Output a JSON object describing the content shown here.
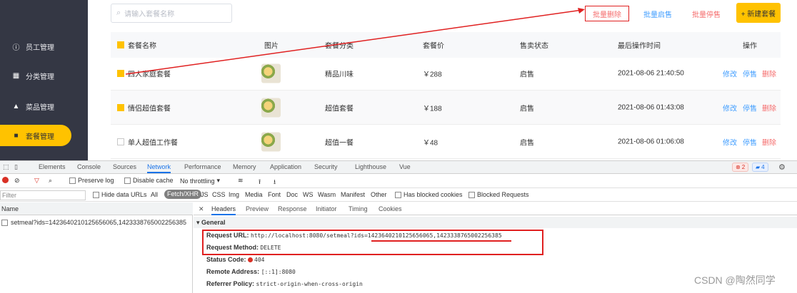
{
  "sidebar": {
    "items": [
      {
        "label": "员工管理",
        "icon": "info-icon"
      },
      {
        "label": "分类管理",
        "icon": "grid-icon"
      },
      {
        "label": "菜品管理",
        "icon": "dish-icon"
      },
      {
        "label": "套餐管理",
        "icon": "gift-icon",
        "active": true
      }
    ]
  },
  "toolbar": {
    "search_placeholder": "请输入套餐名称",
    "batch_delete": "批量删除",
    "batch_on": "批量启售",
    "batch_off": "批量停售",
    "new_button": "+ 新建套餐"
  },
  "table": {
    "headers": [
      "套餐名称",
      "图片",
      "套餐分类",
      "套餐价",
      "售卖状态",
      "最后操作时间",
      "操作"
    ],
    "rows": [
      {
        "name": "四人家庭套餐",
        "category": "精品川味",
        "price": "￥288",
        "status": "启售",
        "time": "2021-08-06 21:40:50",
        "checked": true
      },
      {
        "name": "情侣超值套餐",
        "category": "超值套餐",
        "price": "￥188",
        "status": "启售",
        "time": "2021-08-06 01:43:08",
        "checked": true
      },
      {
        "name": "单人超值工作餐",
        "category": "超值一餐",
        "price": "￥48",
        "status": "启售",
        "time": "2021-08-06 01:06:08",
        "checked": false
      }
    ],
    "ops": {
      "edit": "修改",
      "stop": "停售",
      "del": "删除"
    }
  },
  "devtools": {
    "tabs": [
      "Elements",
      "Console",
      "Sources",
      "Network",
      "Performance",
      "Memory",
      "Application",
      "Security",
      "Lighthouse",
      "Vue"
    ],
    "active_tab": "Network",
    "errors": "2",
    "messages": "4",
    "toolbar": {
      "preserve_log": "Preserve log",
      "disable_cache": "Disable cache",
      "throttling": "No throttling"
    },
    "filter": {
      "placeholder": "Filter",
      "hide_data_urls": "Hide data URLs",
      "all": "All",
      "types": [
        "Fetch/XHR",
        "JS",
        "CSS",
        "Img",
        "Media",
        "Font",
        "Doc",
        "WS",
        "Wasm",
        "Manifest",
        "Other"
      ],
      "blocked_cookies": "Has blocked cookies",
      "blocked_requests": "Blocked Requests"
    },
    "name_header": "Name",
    "request_name": "setmeal?ids=1423640210125656065,1423338765002256385",
    "detail_tabs": [
      "Headers",
      "Preview",
      "Response",
      "Initiator",
      "Timing",
      "Cookies"
    ],
    "general_title": "General",
    "request_url_label": "Request URL:",
    "request_url": "http://localhost:8080/setmeal?ids=1423640210125656065,1423338765002256385",
    "method_label": "Request Method:",
    "method": "DELETE",
    "status_label": "Status Code:",
    "status": "404",
    "remote_label": "Remote Address:",
    "remote": "[::1]:8080",
    "referrer_label": "Referrer Policy:",
    "referrer": "strict-origin-when-cross-origin"
  },
  "watermark": "CSDN @陶然同学",
  "colors": {
    "accent": "#ffc200",
    "sidebar": "#343744",
    "annotation": "#e02020",
    "link": "#419eff"
  }
}
